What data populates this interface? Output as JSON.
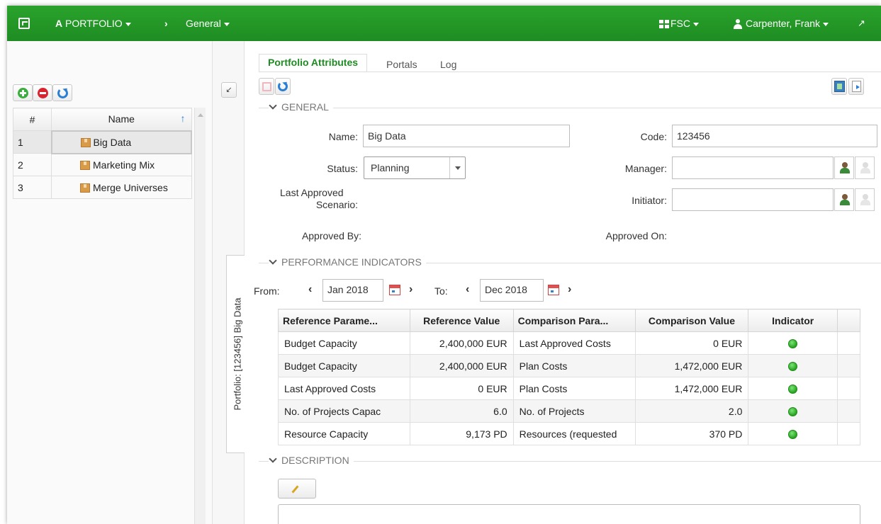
{
  "topbar": {
    "portfolio_label": "PORTFOLIO",
    "breadcrumb_label": "General",
    "org_label": "FSC",
    "user_label": "Carpenter, Frank"
  },
  "list": {
    "headers": {
      "num": "#",
      "name": "Name"
    },
    "rows": [
      {
        "num": "1",
        "name": "Big Data"
      },
      {
        "num": "2",
        "name": "Marketing Mix"
      },
      {
        "num": "3",
        "name": "Merge Universes"
      }
    ]
  },
  "side_tab": {
    "label": "Portfolio: [123456] Big Data"
  },
  "tabs": [
    {
      "label": "Portfolio Attributes"
    },
    {
      "label": "Portals"
    },
    {
      "label": "Log"
    }
  ],
  "sections": {
    "general": "GENERAL",
    "performance": "PERFORMANCE INDICATORS",
    "description": "DESCRIPTION"
  },
  "general": {
    "name_label": "Name:",
    "name_value": "Big Data",
    "code_label": "Code:",
    "code_value": "123456",
    "status_label": "Status:",
    "status_value": "Planning",
    "manager_label": "Manager:",
    "manager_value": "",
    "last_approved_label_1": "Last Approved",
    "last_approved_label_2": "Scenario:",
    "initiator_label": "Initiator:",
    "initiator_value": "",
    "approved_by_label": "Approved By:",
    "approved_on_label": "Approved On:"
  },
  "performance": {
    "from_label": "From:",
    "from_value": "Jan 2018",
    "to_label": "To:",
    "to_value": "Dec 2018",
    "headers": [
      "Reference Parame...",
      "Reference Value",
      "Comparison Para...",
      "Comparison Value",
      "Indicator"
    ],
    "rows": [
      {
        "ref_param": "Budget Capacity",
        "ref_value": "2,400,000 EUR",
        "cmp_param": "Last Approved Costs",
        "cmp_value": "0 EUR",
        "indicator": "green"
      },
      {
        "ref_param": "Budget Capacity",
        "ref_value": "2,400,000 EUR",
        "cmp_param": "Plan Costs",
        "cmp_value": "1,472,000 EUR",
        "indicator": "green"
      },
      {
        "ref_param": "Last Approved Costs",
        "ref_value": "0 EUR",
        "cmp_param": "Plan Costs",
        "cmp_value": "1,472,000 EUR",
        "indicator": "green"
      },
      {
        "ref_param": "No. of Projects Capac",
        "ref_value": "6.0",
        "cmp_param": "No. of Projects",
        "cmp_value": "2.0",
        "indicator": "green"
      },
      {
        "ref_param": "Resource Capacity",
        "ref_value": "9,173 PD",
        "cmp_param": "Resources (requested",
        "cmp_value": "370 PD",
        "indicator": "green"
      }
    ]
  },
  "colors": {
    "topbar": "#1e8c22",
    "active_tab": "#1e8c22",
    "indicator_green": "#25a51f"
  }
}
